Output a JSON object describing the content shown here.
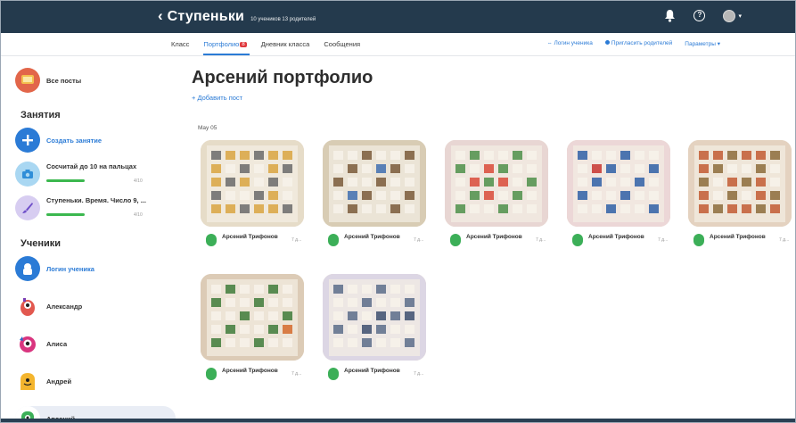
{
  "header": {
    "back_arrow": "‹",
    "title": "Ступеньки",
    "meta": "10 учеников  13 родителей",
    "help_label": "?"
  },
  "tabs": [
    {
      "label": "Класс"
    },
    {
      "label": "Портфолио",
      "badge": "8"
    },
    {
      "label": "Дневник класса"
    },
    {
      "label": "Сообщения"
    }
  ],
  "tab_actions": {
    "student_login": "Логин ученика",
    "invite_parents": "Пригласить родителей",
    "settings": "Параметры ▾"
  },
  "sidebar": {
    "all_posts": "Все посты",
    "lessons_heading": "Занятия",
    "create_lesson": "Создать занятие",
    "lessons": [
      {
        "label": "Сосчитай до 10 на пальцах",
        "count": "4/10"
      },
      {
        "label": "Ступеньки. Время. Число 9, ...",
        "count": "4/10"
      }
    ],
    "students_heading": "Ученики",
    "students": [
      {
        "label": "Логин ученика"
      },
      {
        "label": "Александр"
      },
      {
        "label": "Алиса"
      },
      {
        "label": "Андрей"
      },
      {
        "label": "Арсений"
      }
    ]
  },
  "main": {
    "title": "Арсений портфолио",
    "add_post": "+ Добавить пост",
    "date_heading": "May 05",
    "posts": [
      {
        "author": "Арсений Трифонов",
        "time": "7 д..."
      },
      {
        "author": "Арсений Трифонов",
        "time": "7 д..."
      },
      {
        "author": "Арсений Трифонов",
        "time": "7 д..."
      },
      {
        "author": "Арсений Трифонов",
        "time": "7 д..."
      },
      {
        "author": "Арсений Трифонов",
        "time": "7 д..."
      },
      {
        "author": "Арсений Трифонов",
        "time": "7 д..."
      },
      {
        "author": "Арсений Трифонов",
        "time": "7 д..."
      }
    ]
  },
  "colors": {
    "topbar": "#243a4d",
    "accent": "#2b7bd6",
    "badge": "#e0393e",
    "progress": "#3cb84f",
    "author_avatar": "#3caf58"
  }
}
